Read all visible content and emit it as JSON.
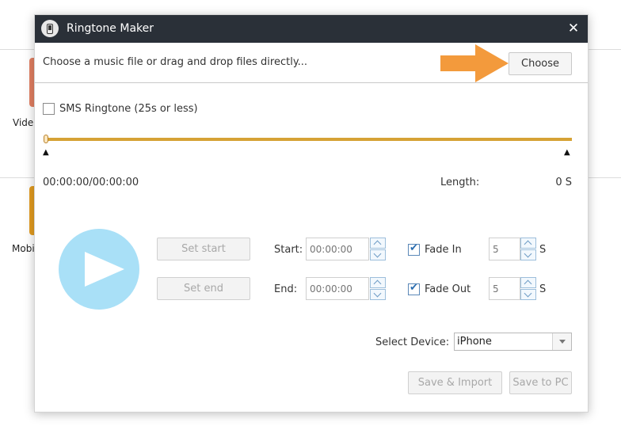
{
  "background": {
    "label_1": "Vide",
    "label_2": "Mobi"
  },
  "dialog": {
    "title": "Ringtone Maker",
    "close_icon": "✕"
  },
  "choose": {
    "prompt": "Choose a music file or drag and drop files directly...",
    "button_label": "Choose"
  },
  "sms": {
    "label": "SMS Ringtone (25s or less)",
    "checked": false
  },
  "timeline": {
    "current_time": "00:00:00/00:00:00",
    "length_label": "Length:",
    "length_value": "0 S"
  },
  "controls": {
    "set_start_label": "Set start",
    "set_end_label": "Set end",
    "start_label": "Start:",
    "start_placeholder": "00:00:00",
    "end_label": "End:",
    "end_placeholder": "00:00:00",
    "fade_in_label": "Fade In",
    "fade_in_value": "5",
    "fade_in_unit": "S",
    "fade_out_label": "Fade Out",
    "fade_out_value": "5",
    "fade_out_unit": "S"
  },
  "device": {
    "label": "Select Device:",
    "selected": "iPhone"
  },
  "footer": {
    "save_import_label": "Save & Import",
    "save_pc_label": "Save to PC"
  },
  "colors": {
    "titlebar": "#2a3038",
    "track": "#d6a235",
    "play_button": "#a9e0f7",
    "arrow": "#f39a3c"
  }
}
